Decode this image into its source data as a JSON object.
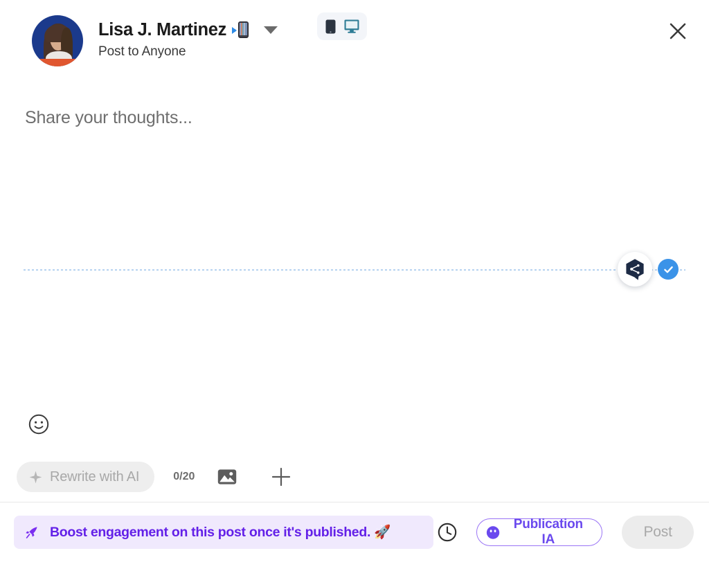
{
  "header": {
    "author_name": "Lisa J. Martinez",
    "name_emoji": "mobile-phone-with-arrow",
    "audience_label": "Post to Anyone",
    "avatar_alt": "Lisa J. Martinez avatar",
    "audience_caret_icon": "chevron-down-icon",
    "close_icon": "close-icon",
    "device_toggle": {
      "mobile_icon": "mobile-device-icon",
      "desktop_icon": "desktop-device-icon"
    }
  },
  "editor": {
    "placeholder": "Share your thoughts...",
    "value": "",
    "brand_badge_icon": "taplio-hexagon-logo-icon",
    "verified_badge_icon": "check-circle-icon"
  },
  "toolbar": {
    "emoji_icon": "emoji-smiley-icon",
    "rewrite_label": "Rewrite with AI",
    "rewrite_icon": "sparkle-icon",
    "char_count": "0/20",
    "image_icon": "image-icon",
    "add_icon": "plus-icon"
  },
  "footer": {
    "boost_text": "Boost engagement on this post once it's published. 🚀",
    "boost_icon": "rocket-purple-icon",
    "schedule_icon": "clock-icon",
    "publication_label": "Publication IA",
    "publication_icon": "purple-face-icon",
    "post_label": "Post"
  },
  "colors": {
    "boost_bg": "#f0e9fd",
    "boost_text": "#6320e8",
    "publication_border": "#9a74f5",
    "publication_text": "#6a49ee",
    "verified_blue": "#3b93e8",
    "dotted_line": "#b5d2f0",
    "post_disabled_bg": "#ececec"
  }
}
